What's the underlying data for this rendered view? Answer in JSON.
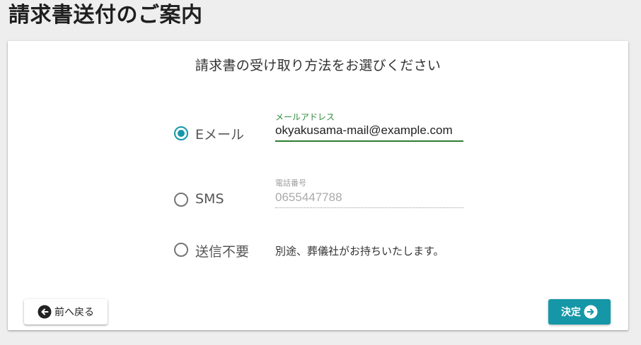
{
  "page": {
    "title": "請求書送付のご案内"
  },
  "card": {
    "heading": "請求書の受け取り方法をお選びください"
  },
  "options": {
    "email": {
      "label": "Eメール",
      "selected": true,
      "field_label": "メールアドレス",
      "value": "okyakusama-mail@example.com"
    },
    "sms": {
      "label": "SMS",
      "selected": false,
      "field_label": "電話番号",
      "placeholder": "0655447788"
    },
    "none": {
      "label": "送信不要",
      "selected": false,
      "note": "別途、葬儀社がお持ちいたします。"
    }
  },
  "buttons": {
    "back_label": "前へ戻る",
    "back_icon": "arrow-left-circle-icon",
    "ok_label": "決定",
    "ok_icon": "arrow-right-circle-icon"
  },
  "colors": {
    "accent": "#1597a8",
    "focus": "#2e7d32",
    "field_label_active": "#2e8b3a"
  }
}
